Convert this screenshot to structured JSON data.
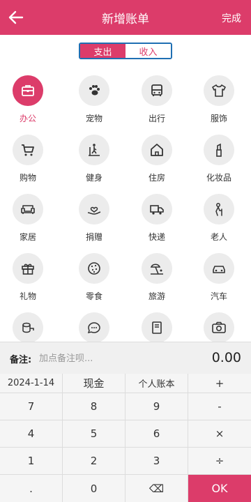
{
  "header": {
    "title": "新增账单",
    "done_label": "完成"
  },
  "tabs": {
    "expense_label": "支出",
    "income_label": "收入",
    "active": "支出"
  },
  "categories": [
    {
      "label": "办公",
      "icon": "briefcase-icon",
      "selected": true
    },
    {
      "label": "宠物",
      "icon": "paw-icon"
    },
    {
      "label": "出行",
      "icon": "bus-icon"
    },
    {
      "label": "服饰",
      "icon": "shirt-icon"
    },
    {
      "label": "购物",
      "icon": "cart-icon"
    },
    {
      "label": "健身",
      "icon": "treadmill-icon"
    },
    {
      "label": "住房",
      "icon": "house-icon"
    },
    {
      "label": "化妆品",
      "icon": "lipstick-icon"
    },
    {
      "label": "家居",
      "icon": "sofa-icon"
    },
    {
      "label": "捐赠",
      "icon": "heart-hand-icon"
    },
    {
      "label": "快递",
      "icon": "truck-icon"
    },
    {
      "label": "老人",
      "icon": "elder-icon"
    },
    {
      "label": "礼物",
      "icon": "gift-icon"
    },
    {
      "label": "零食",
      "icon": "cookie-icon"
    },
    {
      "label": "旅游",
      "icon": "beach-icon"
    },
    {
      "label": "汽车",
      "icon": "car-icon"
    },
    {
      "label": "",
      "icon": "tape-icon"
    },
    {
      "label": "",
      "icon": "chat-icon"
    },
    {
      "label": "",
      "icon": "book-icon"
    },
    {
      "label": "",
      "icon": "camera-icon"
    }
  ],
  "note": {
    "label": "备注:",
    "placeholder": "加点备注呗...",
    "amount": "0.00"
  },
  "keypad": {
    "row1": [
      "2024-1-14",
      "现金",
      "个人账本",
      "+"
    ],
    "row2": [
      "7",
      "8",
      "9",
      "-"
    ],
    "row3": [
      "4",
      "5",
      "6",
      "×"
    ],
    "row4": [
      "1",
      "2",
      "3",
      "÷"
    ],
    "row5": [
      ".",
      "0",
      "⌫",
      "OK"
    ]
  },
  "colors": {
    "accent": "#dc3c6a",
    "tab_border": "#1f6fb3"
  }
}
